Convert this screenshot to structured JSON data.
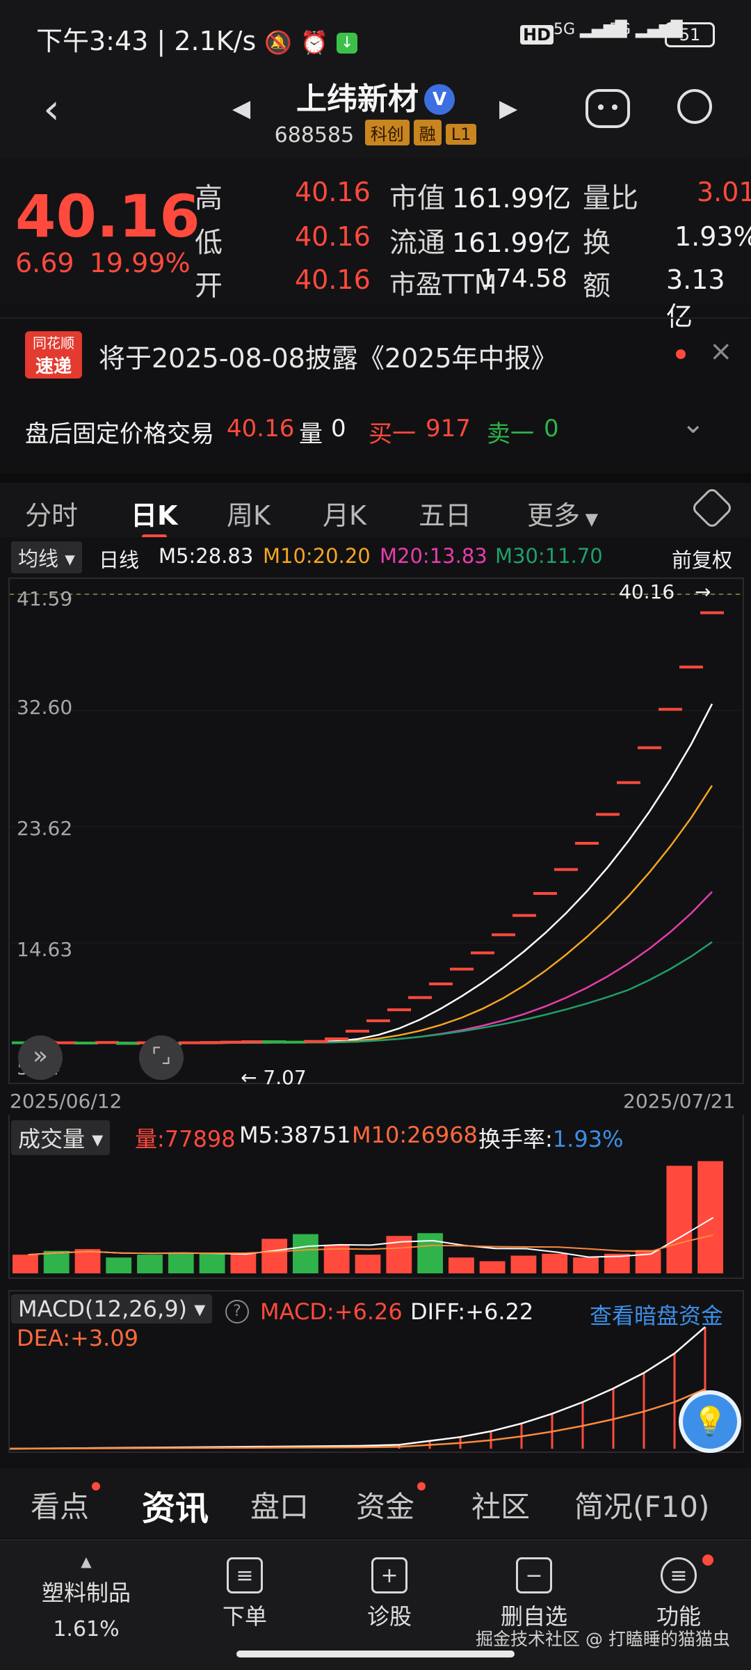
{
  "status_bar": {
    "time": "下午3:43",
    "speed": "2.1K/s",
    "network1": "5G",
    "network2": "5G",
    "battery": "51"
  },
  "header": {
    "title": "上纬新材",
    "verified_mark": "V",
    "code": "688585",
    "tags": [
      "科创",
      "融",
      "L1"
    ]
  },
  "quote": {
    "price": "40.16",
    "change": "6.69",
    "change_pct": "19.99%",
    "rows": [
      {
        "l1": "高",
        "v1": "40.16",
        "l2": "市值",
        "v2": "161.99亿",
        "l3": "量比",
        "v3": "3.01"
      },
      {
        "l1": "低",
        "v1": "40.16",
        "l2": "流通",
        "v2": "161.99亿",
        "l3": "换",
        "v3": "1.93%"
      },
      {
        "l1": "开",
        "v1": "40.16",
        "l2": "市盈TTM",
        "v2": "174.58",
        "l3": "额",
        "v3": "3.13亿"
      }
    ]
  },
  "notice": {
    "logo_line1": "同花顺",
    "logo_line2": "速递",
    "text": "将于2025-08-08披露《2025年中报》"
  },
  "after_hours": {
    "label": "盘后固定价格交易",
    "price": "40.16",
    "vol_label": "量",
    "vol": "0",
    "buy_label": "买一",
    "buy": "917",
    "sell_label": "卖一",
    "sell": "0"
  },
  "chart_tabs": [
    "分时",
    "日K",
    "周K",
    "月K",
    "五日",
    "更多"
  ],
  "ma_legend": {
    "chip": "均线",
    "period": "日线",
    "m5": "M5:28.83",
    "m10": "M10:20.20",
    "m20": "M20:13.83",
    "m30": "M30:11.70",
    "adjust": "前复权"
  },
  "colors": {
    "up": "#ff4a3d",
    "down": "#2fb34a",
    "m5": "#ffffff",
    "m10": "#f5a623",
    "m20": "#e83dae",
    "m30": "#1fa06a",
    "accent_blue": "#3d8fe8"
  },
  "chart_data": [
    {
      "type": "candlestick",
      "x_start_label": "2025/06/12",
      "x_end_label": "2025/07/21",
      "y_ticks": [
        "41.59",
        "32.60",
        "23.62",
        "14.63",
        "5.64"
      ],
      "ylim": [
        5.64,
        41.59
      ],
      "last_price_label": "40.16",
      "low_marker_label": "7.07",
      "closes": [
        6.9,
        6.95,
        6.9,
        6.88,
        6.92,
        6.85,
        6.9,
        6.8,
        6.9,
        6.92,
        6.95,
        6.98,
        6.98,
        6.95,
        7.0,
        7.2,
        7.8,
        8.6,
        9.45,
        10.4,
        11.45,
        12.6,
        13.85,
        15.25,
        16.75,
        18.45,
        20.3,
        22.33,
        24.56,
        27.02,
        29.72,
        32.69,
        35.96,
        40.16
      ],
      "up": [
        false,
        true,
        true,
        false,
        true,
        false,
        true,
        false,
        true,
        true,
        true,
        true,
        false,
        false,
        true,
        true,
        true,
        true,
        true,
        true,
        true,
        true,
        true,
        true,
        true,
        true,
        true,
        true,
        true,
        true,
        true,
        true,
        true,
        true
      ],
      "series": [
        {
          "name": "M5",
          "end": 28.83
        },
        {
          "name": "M10",
          "end": 20.2
        },
        {
          "name": "M20",
          "end": 13.83
        },
        {
          "name": "M30",
          "end": 11.7
        }
      ]
    },
    {
      "type": "bar",
      "label": "成交量",
      "vol": "量:77898",
      "m5": "M5:38751",
      "m10": "M10:26968",
      "turnover_label": "换手率:",
      "turnover": "1.93%",
      "values": [
        20,
        24,
        26,
        17,
        20,
        22,
        22,
        22,
        37,
        42,
        30,
        20,
        40,
        43,
        17,
        13,
        19,
        21,
        17,
        21,
        25,
        115,
        120
      ],
      "up": [
        true,
        false,
        true,
        false,
        false,
        false,
        false,
        true,
        true,
        false,
        true,
        true,
        true,
        false,
        true,
        true,
        true,
        true,
        true,
        true,
        true,
        true,
        true
      ]
    },
    {
      "type": "bar",
      "label": "MACD(12,26,9)",
      "macd": "MACD:+6.26",
      "diff": "DIFF:+6.22",
      "dea": "DEA:+3.09",
      "link": "查看暗盘资金",
      "values": [
        0.2,
        0.4,
        0.6,
        0.9,
        1.3,
        1.8,
        2.4,
        3.1,
        3.9,
        4.9,
        6.26
      ]
    }
  ],
  "section_tabs": [
    "看点",
    "资讯",
    "盘口",
    "资金",
    "社区",
    "简况(F10)"
  ],
  "toolbar": {
    "sector_name": "塑料制品",
    "sector_pct": "1.61%",
    "buttons": [
      "下单",
      "诊股",
      "删自选",
      "功能"
    ],
    "watermark": "掘金技术社区 @ 打瞌睡的猫猫虫"
  }
}
